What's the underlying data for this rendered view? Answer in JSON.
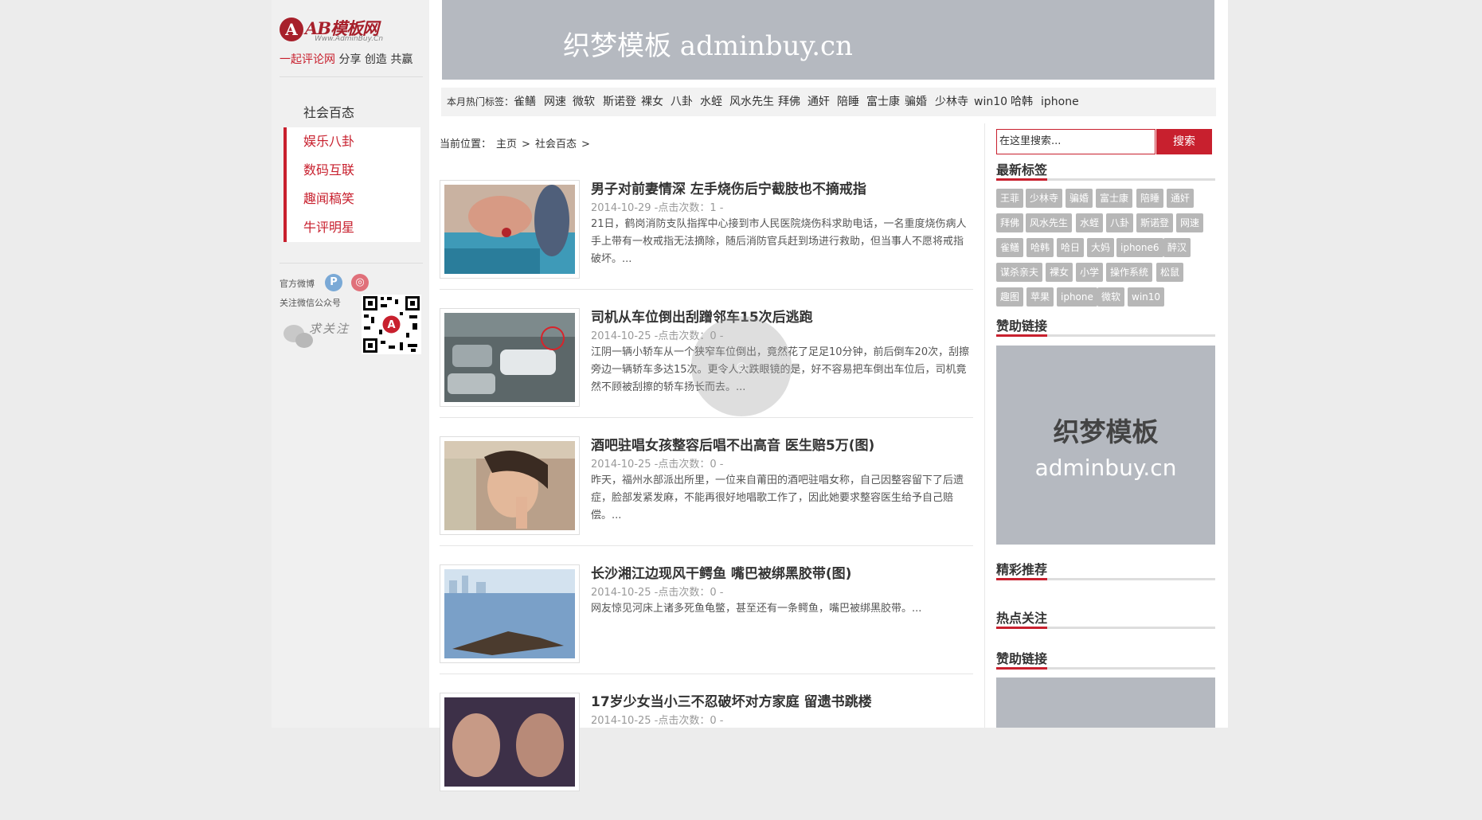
{
  "site": {
    "logo_text": "AB模板网",
    "logo_sub": "Www.AdminBuy.Cn",
    "slogan_red": "一起评论网",
    "slogan_rest": "分享 创造 共赢"
  },
  "sidebar": {
    "items": [
      {
        "label": "社会百态",
        "style": "plain"
      },
      {
        "label": "娱乐八卦",
        "style": "red"
      },
      {
        "label": "数码互联",
        "style": "red"
      },
      {
        "label": "趣闻稿笑",
        "style": "red"
      },
      {
        "label": "牛评明星",
        "style": "red"
      }
    ],
    "weibo_label": "官方微博",
    "wechat_label": "关注微信公众号",
    "wechat_prompt": "求关注"
  },
  "banner": {
    "text": "织梦模板 adminbuy.cn",
    "color": "#b5b9c0"
  },
  "hot_tags": {
    "label": "本月热门标签：",
    "items": [
      "雀鳝",
      "网速",
      "微软",
      "斯诺登",
      "裸女",
      "八卦",
      "水蛭",
      "风水先生",
      "拜佛",
      "通奸",
      "陪睡",
      "富士康",
      "骗婚",
      "少林寺",
      "win10",
      "哈韩",
      "iphone"
    ]
  },
  "breadcrumb": {
    "label": "当前位置：",
    "home": "主页",
    "sep1": ">",
    "current": "社会百态",
    "sep2": ">"
  },
  "articles": [
    {
      "title": "男子对前妻情深 左手烧伤后宁截肢也不摘戒指",
      "meta": "2014-10-29 -点击次数：1 -",
      "desc": "21日，鹤岗消防支队指挥中心接到市人民医院烧伤科求助电话，一名重度烧伤病人手上带有一枚戒指无法摘除，随后消防官兵赶到场进行救助，但当事人不愿将戒指破坏。..."
    },
    {
      "title": "司机从车位倒出刮蹭邻车15次后逃跑",
      "meta": "2014-10-25 -点击次数：0 -",
      "desc": "江阴一辆小轿车从一个狭窄车位倒出，竟然花了足足10分钟，前后倒车20次，刮擦旁边一辆轿车多达15次。更令人大跌眼镜的是，好不容易把车倒出车位后，司机竟然不顾被刮擦的轿车扬长而去。..."
    },
    {
      "title": "酒吧驻唱女孩整容后唱不出高音 医生赔5万(图)",
      "meta": "2014-10-25 -点击次数：0 -",
      "desc": "昨天，福州水部派出所里，一位来自莆田的酒吧驻唱女称，自己因整容留下了后遗症，脸部发紧发麻，不能再很好地唱歌工作了，因此她要求整容医生给予自己赔偿。..."
    },
    {
      "title": "长沙湘江边现风干鳄鱼 嘴巴被绑黑胶带(图)",
      "meta": "2014-10-25 -点击次数：0 -",
      "desc": "网友惊见河床上诸多死鱼龟鳖，甚至还有一条鳄鱼，嘴巴被绑黑胶带。..."
    },
    {
      "title": "17岁少女当小三不忍破坏对方家庭 留遗书跳楼",
      "meta": "2014-10-25 -点击次数：0 -",
      "desc": ""
    }
  ],
  "search": {
    "value": "在这里搜索...",
    "button": "搜索"
  },
  "right": {
    "latest_tags_title": "最新标签",
    "tags": [
      "王菲",
      "少林寺",
      "骗婚",
      "富士康",
      "陪睡",
      "通奸",
      "拜佛",
      "风水先生",
      "水蛭",
      "八卦",
      "斯诺登",
      "网速",
      "雀鳝",
      "哈韩",
      "哈日",
      "大妈",
      "iphone6",
      "醉汉",
      "谋杀亲夫",
      "裸女",
      "小学",
      "操作系统",
      "松鼠",
      "趣图",
      "苹果",
      "iphone",
      "微软",
      "win10"
    ],
    "sponsor_title": "赞助链接",
    "ad_line1": "织梦模板",
    "ad_line2": "adminbuy.cn",
    "featured_title": "精彩推荐",
    "hot_title": "热点关注",
    "sponsor_title2": "赞助链接"
  },
  "colors": {
    "accent": "#c8202e",
    "tag_bg": "#b7b7b7",
    "ad_bg": "#b5b9c0"
  }
}
